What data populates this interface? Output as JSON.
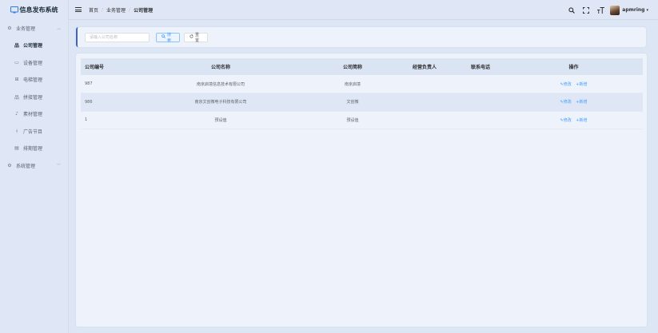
{
  "app": {
    "title": "信息发布系统"
  },
  "sidebar": {
    "groups": [
      {
        "label": "业务管理",
        "icon": "gear-icon"
      },
      {
        "label": "系统管理",
        "icon": "gear-icon"
      }
    ],
    "items": [
      {
        "label": "公司管理",
        "icon": "org-tree-icon",
        "active": true
      },
      {
        "label": "设备管理",
        "icon": "device-icon"
      },
      {
        "label": "电梯管理",
        "icon": "elevator-icon"
      },
      {
        "label": "拼接管理",
        "icon": "tree-icon"
      },
      {
        "label": "素材管理",
        "icon": "music-note-icon"
      },
      {
        "label": "广告节目",
        "icon": "tree-icon"
      },
      {
        "label": "排期管理",
        "icon": "calendar-icon"
      }
    ]
  },
  "header": {
    "breadcrumb": [
      "首页",
      "业务管理",
      "公司管理"
    ],
    "username": "apmring"
  },
  "search": {
    "placeholder": "请输入公司名称",
    "search_label": "搜索",
    "reset_label": "重置"
  },
  "table": {
    "columns": [
      "公司编号",
      "公司名称",
      "公司简称",
      "经营负责人",
      "联系电话",
      "操作"
    ],
    "rows": [
      {
        "id": "987",
        "name": "南京启境信息技术有限公司",
        "short": "南京启境",
        "manager": "",
        "phone": ""
      },
      {
        "id": "986",
        "name": "南京文创微电子科技有限公司",
        "short": "文创微",
        "manager": "",
        "phone": ""
      },
      {
        "id": "1",
        "name": "预设值",
        "short": "预设值",
        "manager": "",
        "phone": ""
      }
    ],
    "actions": {
      "edit": "修改",
      "add": "新增"
    }
  },
  "colors": {
    "accent": "#409eff",
    "sidebar_bg": "#dfe7f6",
    "card_bg": "#edf2fb",
    "bar_accent": "#3f63c9"
  }
}
